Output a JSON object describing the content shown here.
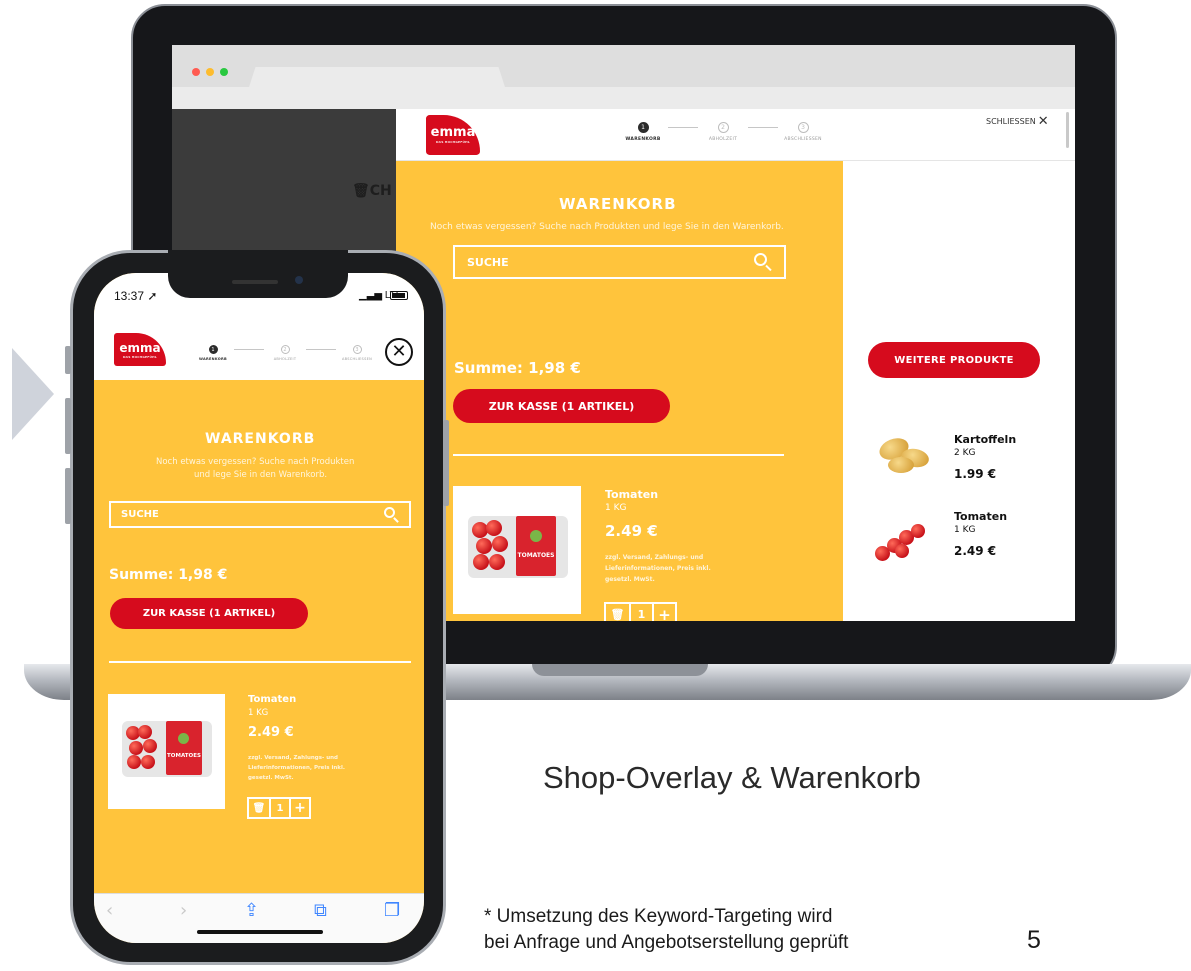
{
  "slide": {
    "title": "Shop-Overlay & Warenkorb",
    "footnote_line1": "* Umsetzung des Keyword-Targeting wird",
    "footnote_line2": "bei Anfrage und Angebotserstellung geprüft",
    "page_number": "5"
  },
  "brand": {
    "logo": "emma",
    "logo_claim": "DAS HOCHGEFÜHL",
    "primary_color": "#d60b1d",
    "accent_color": "#ffc43c"
  },
  "steps": [
    {
      "number": "1",
      "label": "WARENKORB",
      "active": true
    },
    {
      "number": "2",
      "label": "ABHOLZEIT",
      "active": false
    },
    {
      "number": "3",
      "label": "ABSCHLIESSEN",
      "active": false
    }
  ],
  "desktop": {
    "close_label": "SCHLIESSEN",
    "backdrop_text": "CH",
    "cart": {
      "title": "WARENKORB",
      "subtitle": "Noch etwas vergessen? Suche nach Produkten und lege Sie in den Warenkorb.",
      "search_placeholder": "SUCHE",
      "sum": "Summe: 1,98 €",
      "checkout_label": "ZUR KASSE (1 ARTIKEL)"
    },
    "product": {
      "name": "Tomaten",
      "weight": "1 KG",
      "price": "2.49 €",
      "note": "zzgl. Versand, Zahlungs- und Lieferinformationen, Preis inkl. gesetzl. MwSt.",
      "quantity": "1",
      "pack_label": "TOMATOES"
    },
    "recommendations": {
      "button_label": "WEITERE PRODUKTE",
      "items": [
        {
          "name": "Kartoffeln",
          "weight": "2 KG",
          "price": "1.99 €"
        },
        {
          "name": "Tomaten",
          "weight": "1 KG",
          "price": "2.49 €"
        }
      ]
    }
  },
  "mobile": {
    "status_time": "13:37",
    "status_network": "LTE",
    "cart": {
      "title": "WARENKORB",
      "subtitle_line1": "Noch etwas vergessen? Suche nach Produkten",
      "subtitle_line2": "und lege Sie in den Warenkorb.",
      "search_placeholder": "SUCHE",
      "sum": "Summe: 1,98 €",
      "checkout_label": "ZUR KASSE (1 ARTIKEL)"
    },
    "product": {
      "name": "Tomaten",
      "weight": "1 KG",
      "price": "2.49 €",
      "note": "zzgl. Versand, Zahlungs- und Lieferinformationen, Preis inkl. gesetzl. MwSt.",
      "quantity": "1",
      "pack_label": "TOMATOES"
    }
  }
}
